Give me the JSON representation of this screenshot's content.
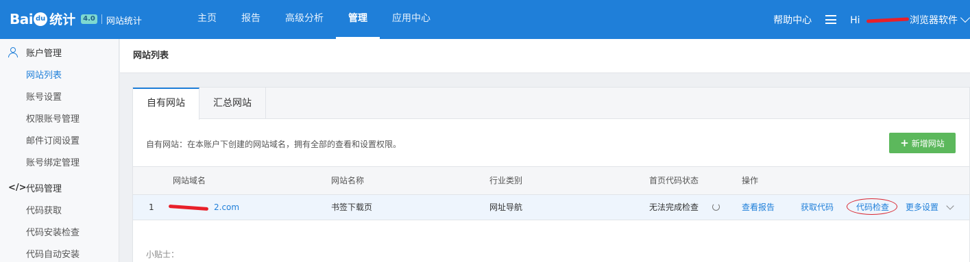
{
  "header": {
    "logo_bai": "Bai",
    "logo_du": "du",
    "logo_tongji": "统计",
    "logo_badge": "4.0",
    "logo_subtitle": "网站统计",
    "nav": [
      "主页",
      "报告",
      "高级分析",
      "管理",
      "应用中心"
    ],
    "nav_active": "管理",
    "help": "帮助中心",
    "user_greeting": "Hi",
    "user_name_suffix": "浏览器软件"
  },
  "sidebar": {
    "account_group": "账户管理",
    "account_items": [
      "网站列表",
      "账号设置",
      "权限账号管理",
      "邮件订阅设置",
      "账号绑定管理"
    ],
    "code_icon": "</>",
    "code_group": "代码管理",
    "code_items": [
      "代码获取",
      "代码安装检查",
      "代码自动安装"
    ]
  },
  "main": {
    "page_title": "网站列表",
    "tabs": [
      "自有网站",
      "汇总网站"
    ],
    "description": "自有网站：在本账户下创建的网站域名，拥有全部的查看和设置权限。",
    "add_button": "新增网站",
    "table": {
      "headers": [
        "网站域名",
        "网站名称",
        "行业类别",
        "首页代码状态",
        "操作"
      ],
      "rows": [
        {
          "index": "1",
          "domain": "2.com",
          "name": "书签下载页",
          "industry": "网址导航",
          "status": "无法完成检查",
          "actions": [
            "查看报告",
            "获取代码",
            "代码检查",
            "更多设置"
          ]
        }
      ]
    },
    "tip": "小贴士："
  },
  "colors": {
    "primary": "#1f7fd9",
    "add_button": "#5cb85c",
    "annotation": "#d9252f"
  }
}
